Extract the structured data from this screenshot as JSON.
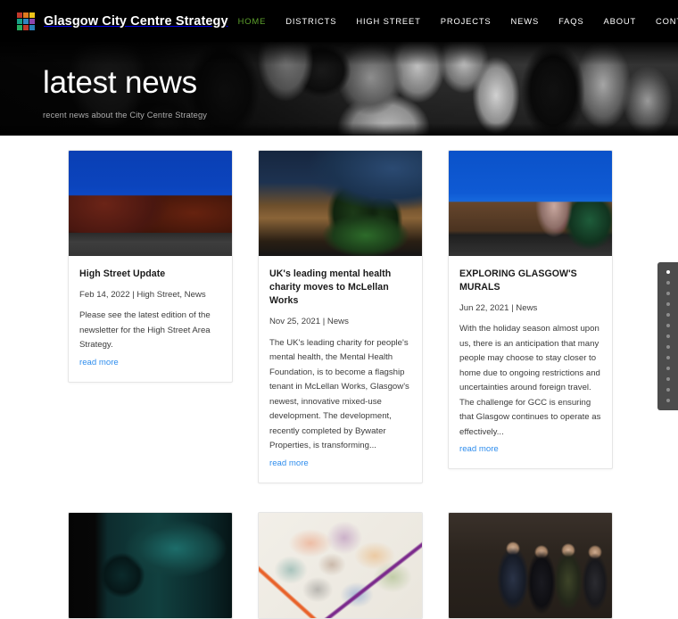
{
  "header": {
    "brand_name": "Glasgow City Centre Strategy",
    "logo_colors": [
      "#c0392b",
      "#e07b1f",
      "#f0c419",
      "#16a085",
      "#2e86c1",
      "#8e44ad",
      "#27ae60",
      "#c0392b",
      "#2980b9"
    ],
    "accent_color": "#5da02c",
    "nav": [
      {
        "label": "HOME",
        "active": true
      },
      {
        "label": "DISTRICTS",
        "active": false
      },
      {
        "label": "HIGH STREET",
        "active": false
      },
      {
        "label": "PROJECTS",
        "active": false
      },
      {
        "label": "NEWS",
        "active": false
      },
      {
        "label": "FAQS",
        "active": false
      },
      {
        "label": "ABOUT",
        "active": false
      },
      {
        "label": "CONTACT",
        "active": false
      }
    ],
    "search_icon": "search-icon"
  },
  "hero": {
    "title": "latest news",
    "subtitle": "recent news about the City Centre Strategy"
  },
  "news": {
    "read_more_label": "read more",
    "cards": [
      {
        "title": "High Street Update",
        "meta": "Feb 14, 2022 | High Street, News",
        "excerpt": "Please see the latest edition of the newsletter for the High Street Area Strategy.",
        "image_name": "high-street-red-sandstone-buildings",
        "image_class": "ph-highstreet"
      },
      {
        "title": "UK's leading mental health charity moves to McLellan Works",
        "meta": "Nov 25, 2021 | News",
        "excerpt": "The UK's leading charity for people's mental health, the Mental Health Foundation, is to become a flagship tenant in McLellan Works, Glasgow's newest, innovative mixed-use development. The development, recently completed by Bywater Properties, is transforming...",
        "image_name": "mclellan-works-sauchiehall-street-dusk",
        "image_class": "ph-dusk"
      },
      {
        "title": "EXPLORING GLASGOW'S MURALS",
        "meta": "Jun 22, 2021 | News",
        "excerpt": "With the holiday season almost upon us, there is an anticipation that many people may choose to stay closer to home due to ongoing restrictions and uncertainties around foreign travel. The challenge for GCC is ensuring that Glasgow continues to operate as effectively...",
        "image_name": "glasgow-mural-gable-wall",
        "image_class": "ph-mural"
      },
      {
        "title": "",
        "meta": "",
        "excerpt": "",
        "image_name": "worlds-kinetic-sculpture-installation-poster",
        "image_class": "ph-kinetic"
      },
      {
        "title": "",
        "meta": "",
        "excerpt": "",
        "image_name": "city-centre-districts-map",
        "image_class": "ph-map"
      },
      {
        "title": "",
        "meta": "",
        "excerpt": "",
        "image_name": "group-photo-four-people",
        "image_class": "ph-group"
      }
    ]
  },
  "dot_nav": {
    "count": 13,
    "active_index": 0
  }
}
